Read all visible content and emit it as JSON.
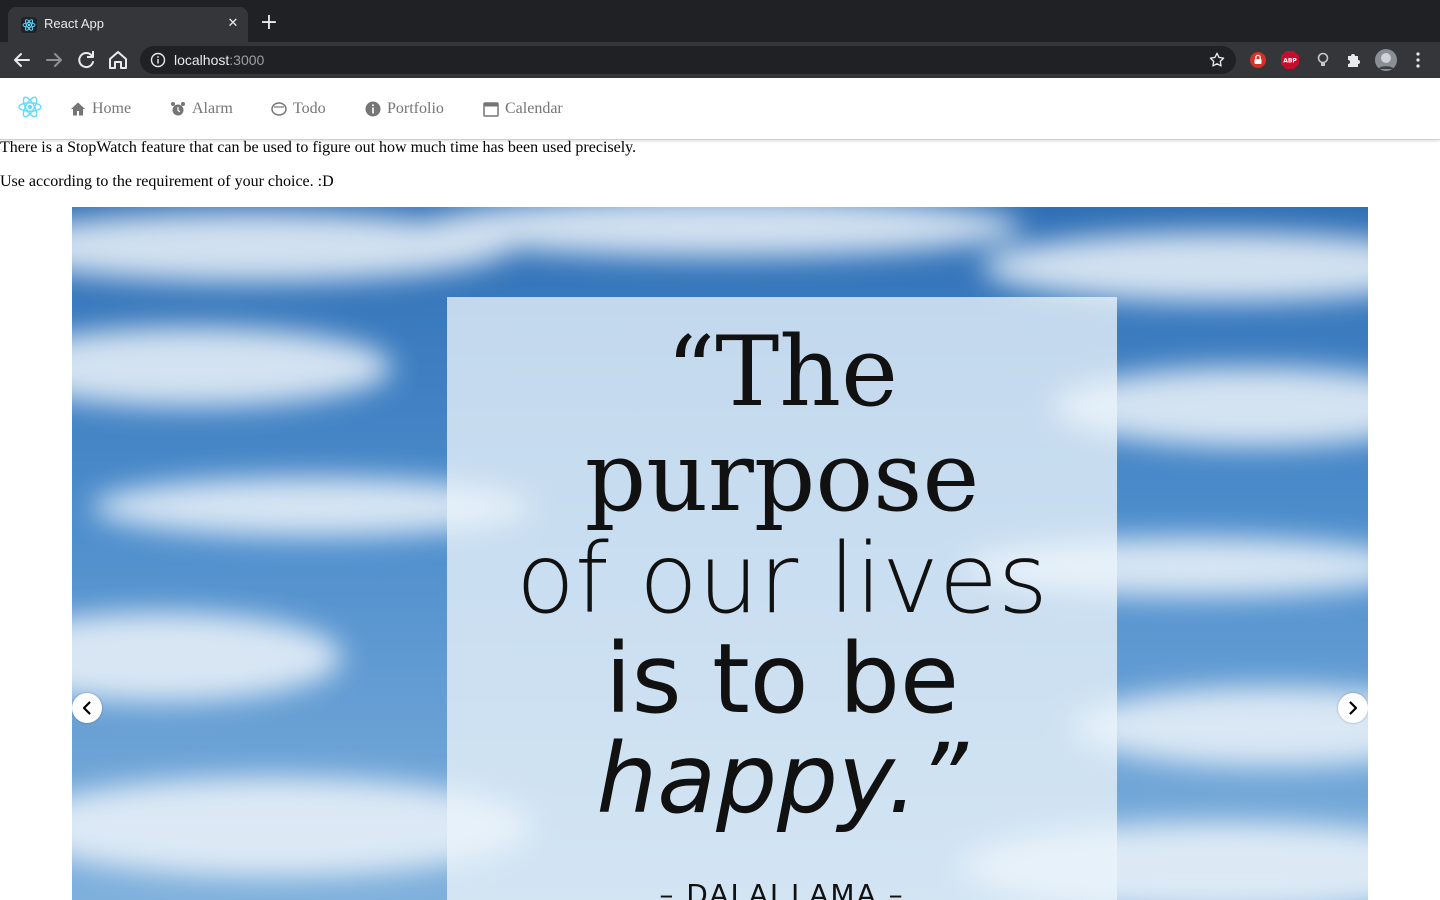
{
  "browser": {
    "tab_title": "React App",
    "tab_close": "✕",
    "new_tab": "+",
    "url_host": "localhost",
    "url_port": ":3000",
    "extensions": {
      "abp_label": "ABP"
    }
  },
  "nav": {
    "items": [
      {
        "label": "Home",
        "icon": "home-icon"
      },
      {
        "label": "Alarm",
        "icon": "alarm-icon"
      },
      {
        "label": "Todo",
        "icon": "todo-icon"
      },
      {
        "label": "Portfolio",
        "icon": "portfolio-icon"
      },
      {
        "label": "Calendar",
        "icon": "calendar-icon"
      }
    ]
  },
  "content": {
    "line1": "There is a StopWatch feature that can be used to figure out how much time has been used precisely.",
    "line2": "Use according to the requirement of your choice. :D"
  },
  "carousel": {
    "quote_lines": [
      "“The",
      "purpose",
      "of our lives",
      "is to be",
      "happy.”"
    ],
    "author": "– DALAI LAMA –"
  },
  "colors": {
    "chrome_dark": "#202124",
    "chrome_mid": "#35363a",
    "nav_text": "#757575",
    "react_blue": "#61dafb"
  }
}
